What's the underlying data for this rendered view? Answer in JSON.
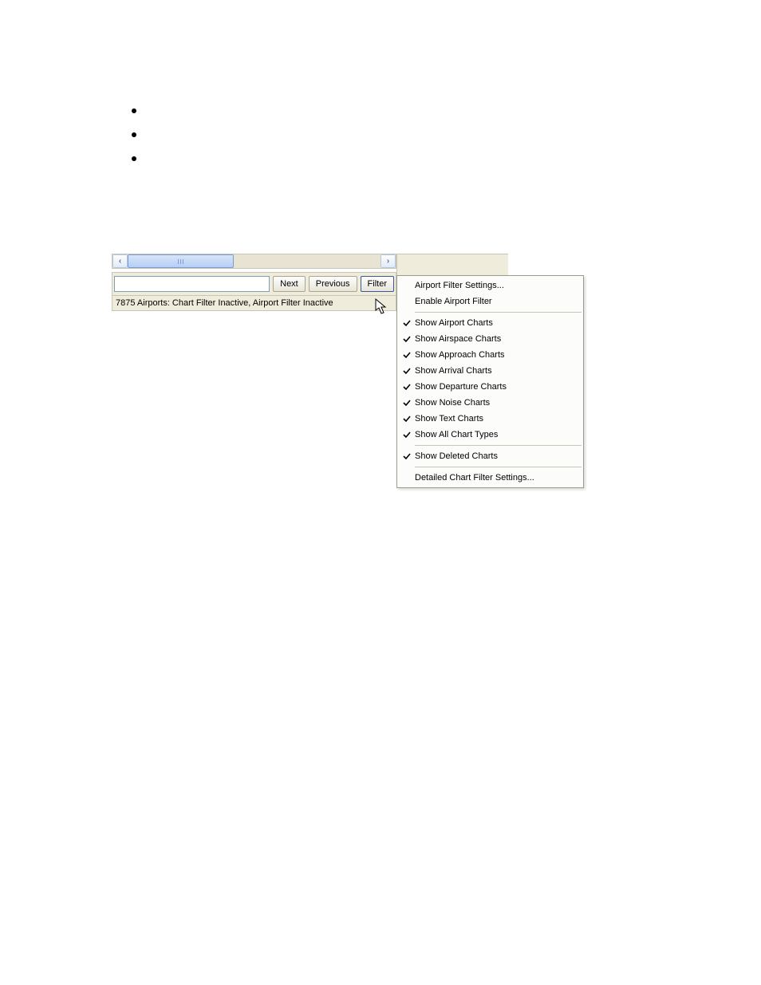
{
  "bullets": [
    "",
    "",
    ""
  ],
  "scrollbar": {
    "left_arrow": "‹",
    "right_arrow": "›"
  },
  "controls": {
    "search_value": "",
    "next_label": "Next",
    "previous_label": "Previous",
    "filter_label": "Filter"
  },
  "status": {
    "text": "7875 Airports: Chart Filter Inactive, Airport Filter Inactive"
  },
  "menu": {
    "group1": [
      {
        "checked": false,
        "label": "Airport Filter Settings..."
      },
      {
        "checked": false,
        "label": "Enable Airport Filter"
      }
    ],
    "group2": [
      {
        "checked": true,
        "label": "Show Airport Charts"
      },
      {
        "checked": true,
        "label": "Show Airspace Charts"
      },
      {
        "checked": true,
        "label": "Show Approach Charts"
      },
      {
        "checked": true,
        "label": "Show Arrival Charts"
      },
      {
        "checked": true,
        "label": "Show Departure Charts"
      },
      {
        "checked": true,
        "label": "Show Noise Charts"
      },
      {
        "checked": true,
        "label": "Show Text Charts"
      },
      {
        "checked": true,
        "label": "Show All Chart Types"
      }
    ],
    "group3": [
      {
        "checked": true,
        "label": "Show Deleted Charts"
      }
    ],
    "group4": [
      {
        "checked": false,
        "label": "Detailed Chart Filter Settings..."
      }
    ]
  }
}
